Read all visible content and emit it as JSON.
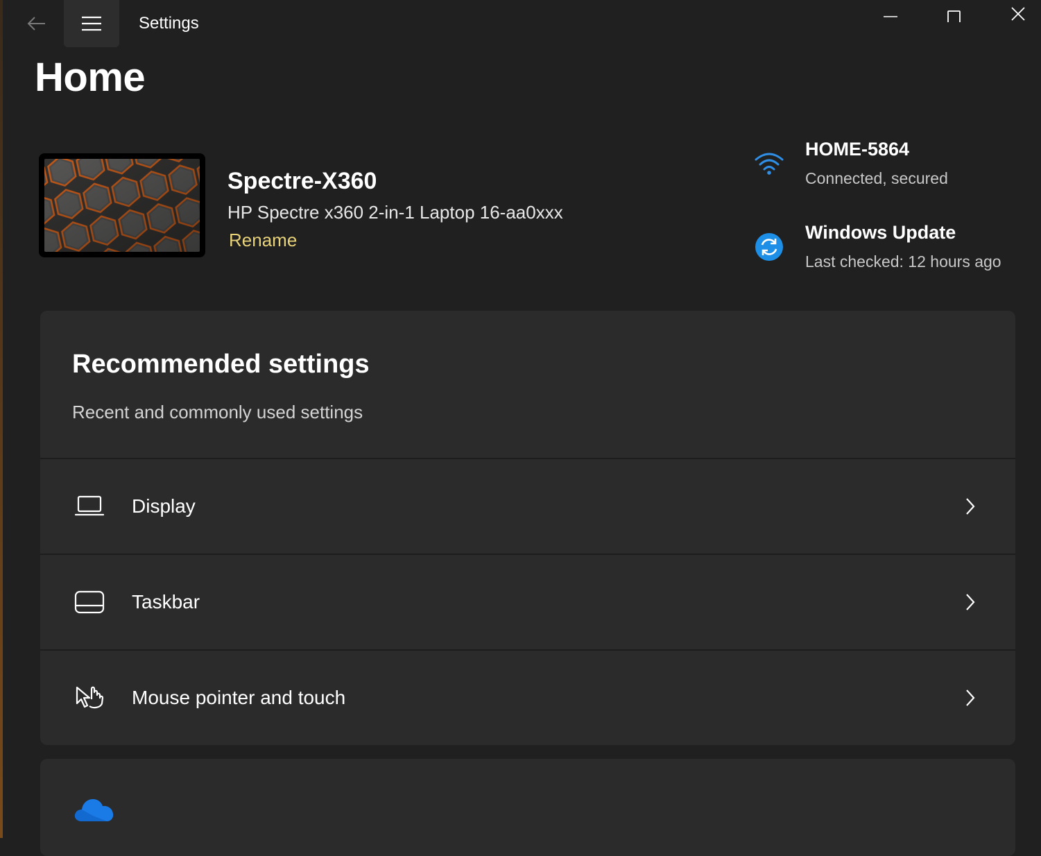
{
  "window": {
    "app_title": "Settings"
  },
  "page": {
    "title": "Home"
  },
  "device": {
    "name": "Spectre-X360",
    "model": "HP Spectre x360 2-in-1 Laptop 16-aa0xxx",
    "rename_label": "Rename"
  },
  "status": {
    "network": {
      "name": "HOME-5864",
      "detail": "Connected, secured",
      "icon": "wifi-icon"
    },
    "update": {
      "name": "Windows Update",
      "detail": "Last checked: 12 hours ago",
      "icon": "sync-icon"
    }
  },
  "recommended": {
    "title": "Recommended settings",
    "subtitle": "Recent and commonly used settings",
    "items": [
      {
        "label": "Display",
        "icon": "laptop-display-icon"
      },
      {
        "label": "Taskbar",
        "icon": "taskbar-icon"
      },
      {
        "label": "Mouse pointer and touch",
        "icon": "pointer-touch-icon"
      }
    ]
  },
  "colors": {
    "background": "#202020",
    "card": "#2b2b2b",
    "accent_link": "#e8d27a",
    "accent_blue": "#1e8fe6"
  }
}
